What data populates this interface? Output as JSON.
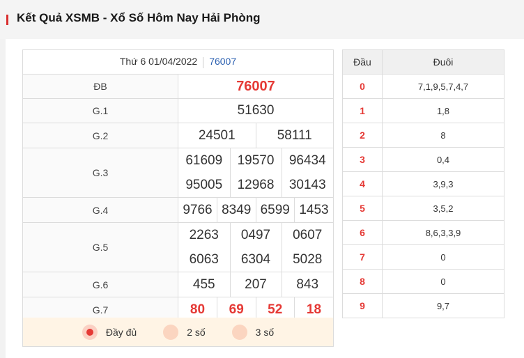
{
  "header": {
    "title": "Kết Quả XSMB - Xổ Số Hôm Nay Hải Phòng"
  },
  "meta": {
    "date": "Thứ 6 01/04/2022",
    "code": "76007"
  },
  "prizes": {
    "db": {
      "label": "ĐB",
      "values": [
        "76007"
      ]
    },
    "g1": {
      "label": "G.1",
      "values": [
        "51630"
      ]
    },
    "g2": {
      "label": "G.2",
      "values": [
        "24501",
        "58111"
      ]
    },
    "g3": {
      "label": "G.3",
      "values": [
        "61609",
        "19570",
        "96434",
        "95005",
        "12968",
        "30143"
      ]
    },
    "g4": {
      "label": "G.4",
      "values": [
        "9766",
        "8349",
        "6599",
        "1453"
      ]
    },
    "g5": {
      "label": "G.5",
      "values": [
        "2263",
        "0497",
        "0607",
        "6063",
        "6304",
        "5028"
      ]
    },
    "g6": {
      "label": "G.6",
      "values": [
        "455",
        "207",
        "843"
      ]
    },
    "g7": {
      "label": "G.7",
      "values": [
        "80",
        "69",
        "52",
        "18"
      ]
    }
  },
  "options": [
    {
      "label": "Đầy đủ",
      "selected": true
    },
    {
      "label": "2 số",
      "selected": false
    },
    {
      "label": "3 số",
      "selected": false
    }
  ],
  "loto": {
    "headers": [
      "Đầu",
      "Đuôi"
    ],
    "rows": [
      {
        "dau": "0",
        "duoi": "7,1,9,5,7,4,7"
      },
      {
        "dau": "1",
        "duoi": "1,8"
      },
      {
        "dau": "2",
        "duoi": "8"
      },
      {
        "dau": "3",
        "duoi": "0,4"
      },
      {
        "dau": "4",
        "duoi": "3,9,3"
      },
      {
        "dau": "5",
        "duoi": "3,5,2"
      },
      {
        "dau": "6",
        "duoi": "8,6,3,3,9"
      },
      {
        "dau": "7",
        "duoi": "0"
      },
      {
        "dau": "8",
        "duoi": "0"
      },
      {
        "dau": "9",
        "duoi": "9,7"
      }
    ]
  },
  "colors": {
    "accent": "#e53935",
    "code_link": "#2a5fb0",
    "option_bg": "#fff4e5"
  }
}
